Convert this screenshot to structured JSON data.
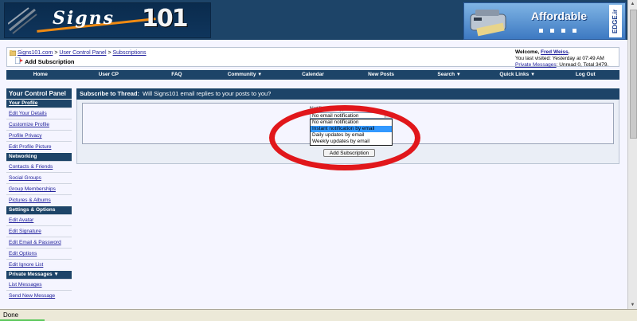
{
  "header": {
    "logo_text": "Signs",
    "logo_number": "101",
    "ad_text": "Affordable",
    "ad_brand": "EDGE.ir"
  },
  "breadcrumb": {
    "links": [
      "Signs101.com",
      "User Control Panel",
      "Subscriptions"
    ],
    "separator": ">",
    "page_title": "Add Subscription"
  },
  "welcome": {
    "greeting": "Welcome,",
    "user": "Fred Weiss",
    "last_visited": "You last visited: Yesterday at 07:49 AM",
    "pm_link": "Private Messages",
    "pm_stats": ": Unread 0, Total 3479."
  },
  "nav": [
    "Home",
    "User CP",
    "FAQ",
    "Community",
    "Calendar",
    "New Posts",
    "Search",
    "Quick Links",
    "Log Out"
  ],
  "nav_dropdowns": [
    "Community",
    "Search",
    "Quick Links"
  ],
  "sidebar": {
    "title": "Your Control Panel",
    "sections": [
      {
        "heading": "Your Profile",
        "items": [
          "Edit Your Details",
          "Customize Profile",
          "Profile Privacy",
          "Edit Profile Picture"
        ]
      },
      {
        "heading": "Networking",
        "items": [
          "Contacts & Friends",
          "Social Groups",
          "Group Memberships",
          "Pictures & Albums"
        ]
      },
      {
        "heading": "Settings & Options",
        "items": [
          "Edit Avatar",
          "Edit Signature",
          "Edit Email & Password",
          "Edit Options",
          "Edit Ignore List"
        ]
      },
      {
        "heading": "Private Messages",
        "items": [
          "List Messages",
          "Send New Message"
        ]
      }
    ]
  },
  "main": {
    "title_bold": "Subscribe to Thread:",
    "title_rest": "Will Signs101 email replies to your posts to you?",
    "fieldset_label": "Notification Type:",
    "selected": "No email notification",
    "options": [
      "No email notification",
      "Instant notification by email",
      "Daily updates by email",
      "Weekly updates by email"
    ],
    "highlighted_option": "Instant notification by email",
    "submit_label": "Add Subscription"
  },
  "statusbar": {
    "text": "Done"
  },
  "colors": {
    "header": "#1d4468",
    "annotation_circle": "#e1171b",
    "link": "#22229c",
    "highlight": "#3399ff"
  }
}
